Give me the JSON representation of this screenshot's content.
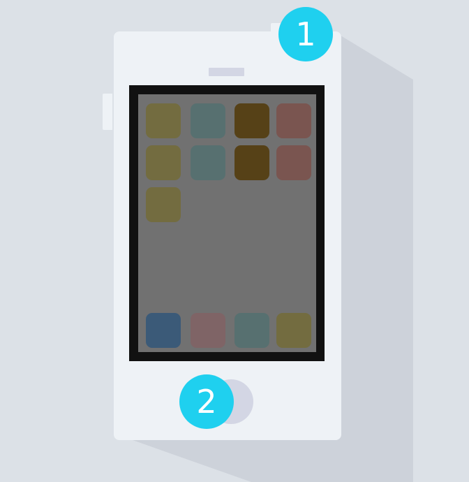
{
  "colors": {
    "background": "#dce1e7",
    "phone_body": "#eef2f6",
    "bezel": "#111111",
    "screen": "#717171",
    "speaker_and_home": "#d3d6e4",
    "badge": "#1fd0ef",
    "shadow": "#cdd2da"
  },
  "screen_apps": {
    "grid_rows": [
      [
        "olive",
        "teal",
        "brown",
        "rust"
      ],
      [
        "olive",
        "teal",
        "brown",
        "rust"
      ],
      [
        "olive"
      ]
    ],
    "dock": [
      "blue",
      "mauve",
      "teal",
      "olive"
    ],
    "palette": {
      "olive": "#736c40",
      "teal": "#577070",
      "brown": "#564117",
      "rust": "#7a5550",
      "blue": "#3b5a78",
      "mauve": "#7f6466"
    }
  },
  "callouts": {
    "one": "1",
    "two": "2"
  }
}
